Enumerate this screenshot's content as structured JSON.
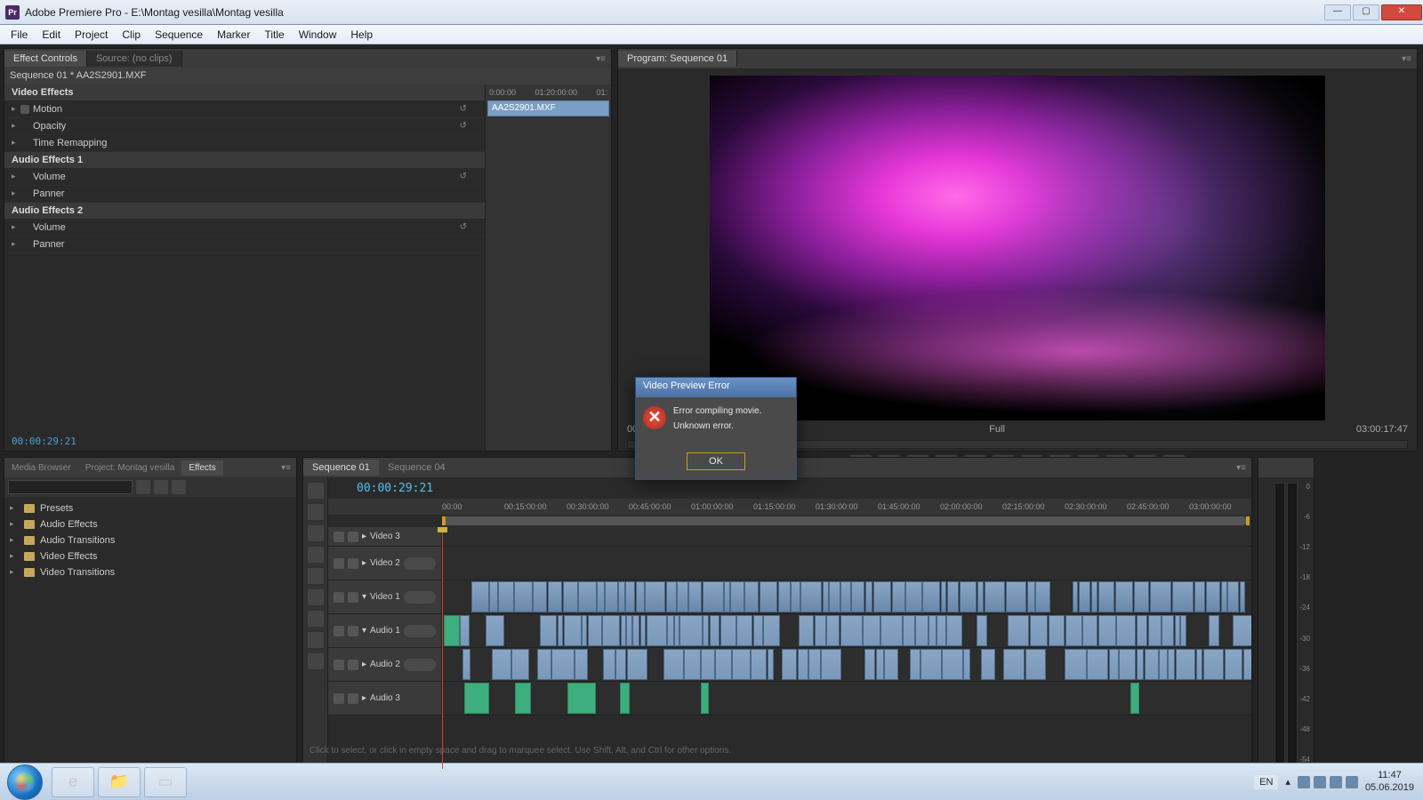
{
  "window": {
    "app_abbrev": "Pr",
    "title": "Adobe Premiere Pro - E:\\Montag vesilla\\Montag vesilla",
    "controls": {
      "min": "—",
      "max": "▢",
      "close": "✕"
    }
  },
  "menubar": [
    "File",
    "Edit",
    "Project",
    "Clip",
    "Sequence",
    "Marker",
    "Title",
    "Window",
    "Help"
  ],
  "effect_controls": {
    "tabs": [
      "Effect Controls",
      "Source: (no clips)"
    ],
    "active_tab": 0,
    "clip_header": "Sequence 01 * AA2S2901.MXF",
    "timeline_labels": [
      "0:00:00",
      "01:20:00:00",
      "01:"
    ],
    "timeline_clipname": "AA2S2901.MXF",
    "video_effects": "Video Effects",
    "video_rows": [
      "Motion",
      "Opacity",
      "Time Remapping"
    ],
    "audio_effects_1": "Audio Effects 1",
    "audio_effects_2": "Audio Effects 2",
    "audio_rows": [
      "Volume",
      "Panner"
    ],
    "current_time": "00:00:29:21"
  },
  "program_monitor": {
    "tab": "Program: Sequence 01",
    "left_time": "00",
    "fit_label": "Full",
    "right_time": "03:00:17:47",
    "transport_icons": [
      "♥",
      "{",
      "}",
      "|◀",
      "◀",
      "▶",
      "▶|",
      "▶▶",
      "▶|",
      "⊞",
      "⊡",
      "📷"
    ]
  },
  "effects_browser": {
    "tabs": [
      "Media Browser",
      "Project: Montag vesilla",
      "Effects"
    ],
    "active_tab": 2,
    "search_placeholder": "",
    "folders": [
      "Presets",
      "Audio Effects",
      "Audio Transitions",
      "Video Effects",
      "Video Transitions"
    ]
  },
  "timeline": {
    "tabs": [
      "Sequence 01",
      "Sequence 04"
    ],
    "active_tab": 0,
    "timecode": "00:00:29:21",
    "ruler": [
      "00:00",
      "00:15:00:00",
      "00:30:00:00",
      "00:45:00:00",
      "01:00:00:00",
      "01:15:00:00",
      "01:30:00:00",
      "01:45:00:00",
      "02:00:00:00",
      "02:15:00:00",
      "02:30:00:00",
      "02:45:00:00",
      "03:00:00:00"
    ],
    "tracks": {
      "v3": "Video 3",
      "v2": "Video 2",
      "v1": "Video 1",
      "a1": "Audio 1",
      "a2": "Audio 2",
      "a3": "Audio 3"
    }
  },
  "audio_meters": {
    "scale": [
      "0",
      "-6",
      "-12",
      "-18",
      "-24",
      "-30",
      "-36",
      "-42",
      "-48",
      "-54"
    ]
  },
  "dialog": {
    "title": "Video Preview Error",
    "line1": "Error compiling movie.",
    "line2": "Unknown error.",
    "ok": "OK"
  },
  "hint": "Click to select, or click in empty space and drag to marquee select. Use Shift, Alt, and Ctrl for other options.",
  "taskbar": {
    "lang": "EN",
    "time": "11:47",
    "date": "05.06.2019"
  }
}
